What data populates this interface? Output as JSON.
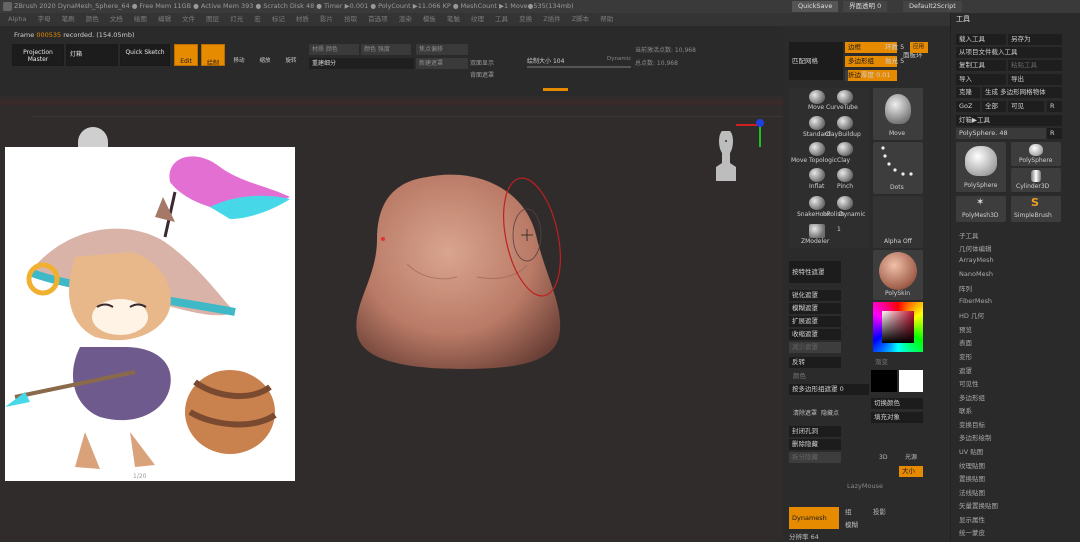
{
  "titlebar": {
    "text": "ZBrush 2020   DynaMesh_Sphere_64   ● Free Mem 11GB  ● Active Mem 393  ● Scratch Disk 48  ● Timer ▶0.001  ● PolyCount ▶11.066 KP  ● MeshCount ▶1  Move●535(134mb)",
    "quicksave": "QuickSave",
    "transparency": "界面透明 0",
    "zscript": "Default2Script"
  },
  "menubar": {
    "items": [
      "Alpha",
      "字母",
      "笔刷",
      "颜色",
      "文档",
      "绘图",
      "编辑",
      "文件",
      "图层",
      "灯光",
      "宏",
      "标记",
      "材质",
      "影片",
      "拾取",
      "首选项",
      "渲染",
      "模板",
      "笔触",
      "纹理",
      "工具",
      "变换",
      "Z插件",
      "Z脚本",
      "帮助"
    ]
  },
  "toolbar": {
    "frame_label": "Frame",
    "frame_number": "000535",
    "frame_info": "recorded. (154.05mb)",
    "projection_master": "Projection Master",
    "lightbox": "灯箱",
    "quick_sketch": "Quick Sketch",
    "edit_label": "Edit",
    "draw_label": "绘制",
    "move_label": "移动",
    "scale_label": "缩放",
    "rotate_label": "旋转",
    "mrgb_field": "材质 颜色",
    "rgb_field": "颜色 强度",
    "focal_shift": "焦点偏移",
    "subdiv_field": "重建细分",
    "draw_size_label": "绘制大小",
    "draw_size_value": "104",
    "dynamic_label": "Dynamic",
    "active_points": "当前激活点数: 10,968",
    "total_points": "总点数: 10,968",
    "backface": "背面遮罩",
    "smooth_field": "新建遮罩",
    "display_field": "双面显示"
  },
  "palette": {
    "match_mesh": "匹配网格",
    "edges_label": "边框",
    "polyframe": "多边形组",
    "crease": "折边",
    "preview_label": "面板环",
    "loops_label": "环数",
    "loops_value": "5",
    "polish_label": "抛光",
    "polish_value": "5",
    "thickness_label": "厚度",
    "thickness_value": "0.01",
    "apply_btn": "应用",
    "brushes": [
      {
        "name": "Move"
      },
      {
        "name": "CurveTube"
      },
      {
        "name": "Standard"
      },
      {
        "name": "ClayBuildup"
      },
      {
        "name": "Move Topologic"
      },
      {
        "name": "Clay"
      },
      {
        "name": "Inflat"
      },
      {
        "name": "Pinch"
      },
      {
        "name": "SnakeHook"
      },
      {
        "name": "hPolish"
      },
      {
        "name": "Dynamic"
      },
      {
        "name": "ZModeler"
      },
      {
        "name": "1"
      }
    ],
    "current_brush": "Move",
    "stroke": "Dots",
    "alpha": "Alpha Off",
    "material": "PolySkin",
    "mask_by_feature": "按特性遮罩",
    "mask_items": [
      "锐化遮罩",
      "模糊遮罩",
      "扩展遮罩",
      "收缩遮罩",
      "减少遮罩"
    ],
    "invert": "反转",
    "swatch_label": "渐变",
    "color_label": "颜色",
    "mask_by_polygroup": "按多边形组遮罩",
    "mask_polygroup_value": "0",
    "switch_color": "切换颜色",
    "fill_object": "填充对象",
    "gizmo_label": "显示",
    "dynamesh": "Dynamesh",
    "blur_label": "模糊",
    "groups_label": "组",
    "project_label": "投影",
    "resolution_label": "分辨率",
    "resolution_value": "64",
    "lazymouse": "LazyMouse",
    "clear_mask": "清除遮罩",
    "hide_pt": "隐藏点",
    "delete_hidden": "删除隐藏",
    "close_holes": "封闭孔洞",
    "split_hidden": "拆分隐藏",
    "gizmo3d": "3D",
    "lightbox_icon": "光源",
    "size": "大小"
  },
  "toolpanel": {
    "header": "工具",
    "load_tool": "载入工具",
    "save_as": "另存为",
    "load_from_project": "从项目文件载入工具",
    "copy_tool": "复制工具",
    "paste_tool": "粘贴工具",
    "import": "导入",
    "export": "导出",
    "clone": "克隆",
    "make_polymesh": "生成 多边形网格物体",
    "goz": "GoZ",
    "all": "全部",
    "visible": "可见",
    "r_btn": "R",
    "lightbox_tools": "灯箱▶工具",
    "polysphere_value": "PolySphere. 48",
    "tools": [
      {
        "name": "PolySphere"
      },
      {
        "name": "PolySphere"
      },
      {
        "name": "Cylinder3D"
      },
      {
        "name": "PolyMesh3D"
      },
      {
        "name": "SimpleBrush"
      }
    ],
    "sections": [
      "子工具",
      "几何体编辑",
      "ArrayMesh",
      "NanoMesh",
      "阵列",
      "FiberMesh",
      "HD 几何",
      "预览",
      "表面",
      "变形",
      "遮罩",
      "可见性",
      "多边形组",
      "联系",
      "变换目标",
      "多边形绘制",
      "UV 贴图",
      "纹理贴图",
      "置换贴图",
      "法线贴图",
      "矢量置换贴图",
      "显示属性",
      "统一蒙皮"
    ]
  },
  "reference": {
    "page_counter": "1/20"
  }
}
